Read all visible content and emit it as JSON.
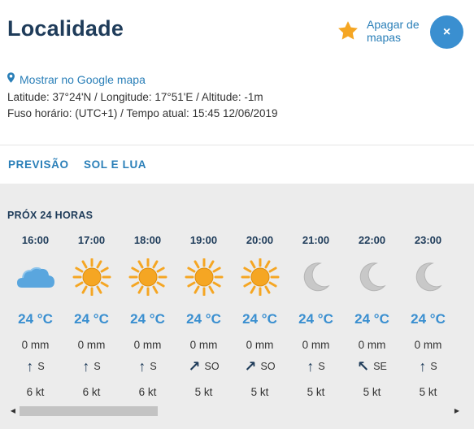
{
  "header": {
    "title": "Localidade",
    "favorite_label": "Apagar de mapas",
    "close_symbol": "×"
  },
  "location": {
    "map_link": "Mostrar no Google mapa",
    "coordinates": "Latitude: 37°24'N / Longitude: 17°51'E / Altitude: -1m",
    "timezone": "Fuso horário:  (UTC+1) / Tempo atual: 15:45 12/06/2019"
  },
  "tabs": [
    {
      "label": "PREVISÃO"
    },
    {
      "label": "SOL E LUA"
    }
  ],
  "forecast": {
    "title": "PRÓX 24 HORAS",
    "hours": [
      {
        "time": "16:00",
        "icon": "cloud-icon",
        "temp": "24 °C",
        "rain": "0 mm",
        "wind_arrow": "↑",
        "wind_dir": "S",
        "speed": "6 kt"
      },
      {
        "time": "17:00",
        "icon": "sun-icon",
        "temp": "24 °C",
        "rain": "0 mm",
        "wind_arrow": "↑",
        "wind_dir": "S",
        "speed": "6 kt"
      },
      {
        "time": "18:00",
        "icon": "sun-icon",
        "temp": "24 °C",
        "rain": "0 mm",
        "wind_arrow": "↑",
        "wind_dir": "S",
        "speed": "6 kt"
      },
      {
        "time": "19:00",
        "icon": "sun-icon",
        "temp": "24 °C",
        "rain": "0 mm",
        "wind_arrow": "↗",
        "wind_dir": "SO",
        "speed": "5 kt"
      },
      {
        "time": "20:00",
        "icon": "sun-icon",
        "temp": "24 °C",
        "rain": "0 mm",
        "wind_arrow": "↗",
        "wind_dir": "SO",
        "speed": "5 kt"
      },
      {
        "time": "21:00",
        "icon": "moon-icon",
        "temp": "24 °C",
        "rain": "0 mm",
        "wind_arrow": "↑",
        "wind_dir": "S",
        "speed": "5 kt"
      },
      {
        "time": "22:00",
        "icon": "moon-icon",
        "temp": "24 °C",
        "rain": "0 mm",
        "wind_arrow": "↖",
        "wind_dir": "SE",
        "speed": "5 kt"
      },
      {
        "time": "23:00",
        "icon": "moon-icon",
        "temp": "24 °C",
        "rain": "0 mm",
        "wind_arrow": "↑",
        "wind_dir": "S",
        "speed": "5 kt"
      }
    ]
  },
  "scroll": {
    "left_arrow": "◀",
    "right_arrow": "▶",
    "position_fraction": 0.0,
    "visible_fraction": 0.32
  },
  "colors": {
    "title": "#1f3c5a",
    "link": "#2a7fb8",
    "accent": "#3a8fd0",
    "star": "#f5a623",
    "sun": "#f5a623",
    "cloud": "#5aa6de",
    "moon": "#c8c8c8"
  }
}
